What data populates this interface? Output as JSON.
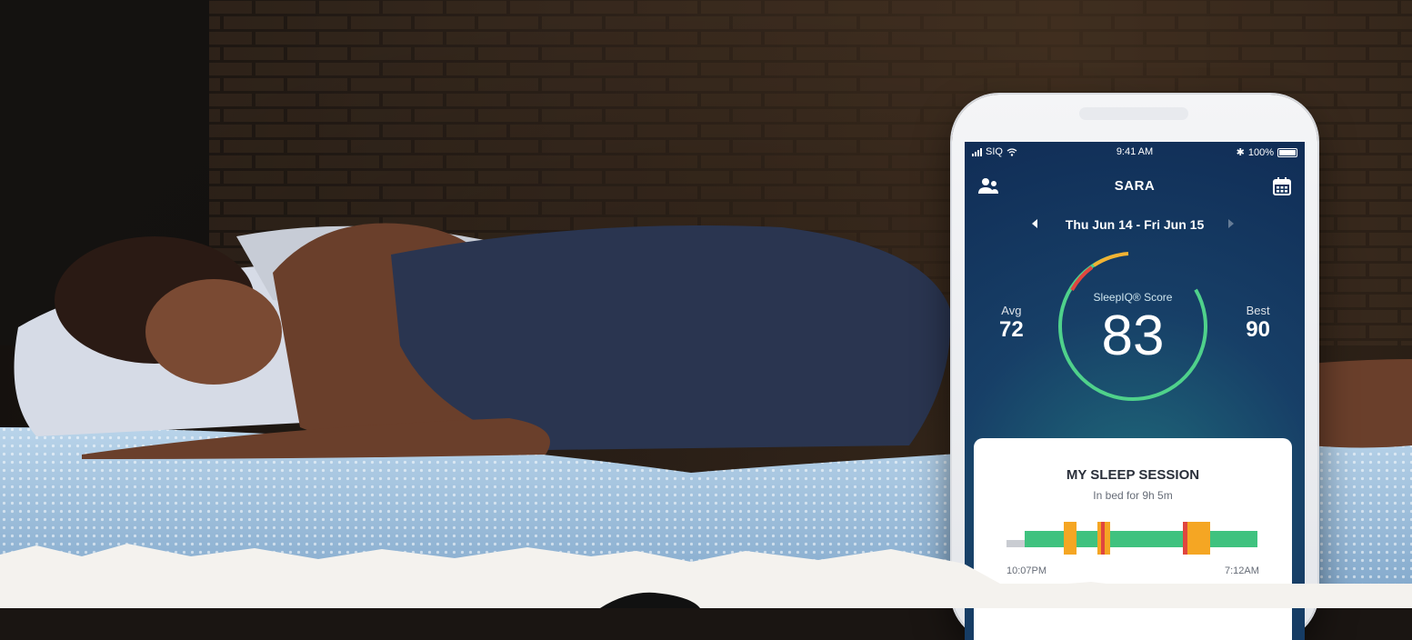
{
  "status_bar": {
    "carrier": "SIQ",
    "time": "9:41 AM",
    "battery": "100%"
  },
  "header": {
    "user_name": "SARA"
  },
  "date_nav": {
    "range": "Thu Jun 14 - Fri Jun 15"
  },
  "score": {
    "label": "SleepIQ® Score",
    "value": "83",
    "avg_label": "Avg",
    "avg_value": "72",
    "best_label": "Best",
    "best_value": "90"
  },
  "session": {
    "title": "MY SLEEP SESSION",
    "subtitle": "In bed for 9h 5m",
    "start_time": "10:07PM",
    "end_time": "7:12AM"
  },
  "colors": {
    "ring_green": "#4fd18b",
    "ring_yellow": "#f2b233",
    "ring_red": "#e0463f",
    "restful": "#3fc27f",
    "restless": "#f5a623",
    "out_of_bed": "#e0463f"
  }
}
